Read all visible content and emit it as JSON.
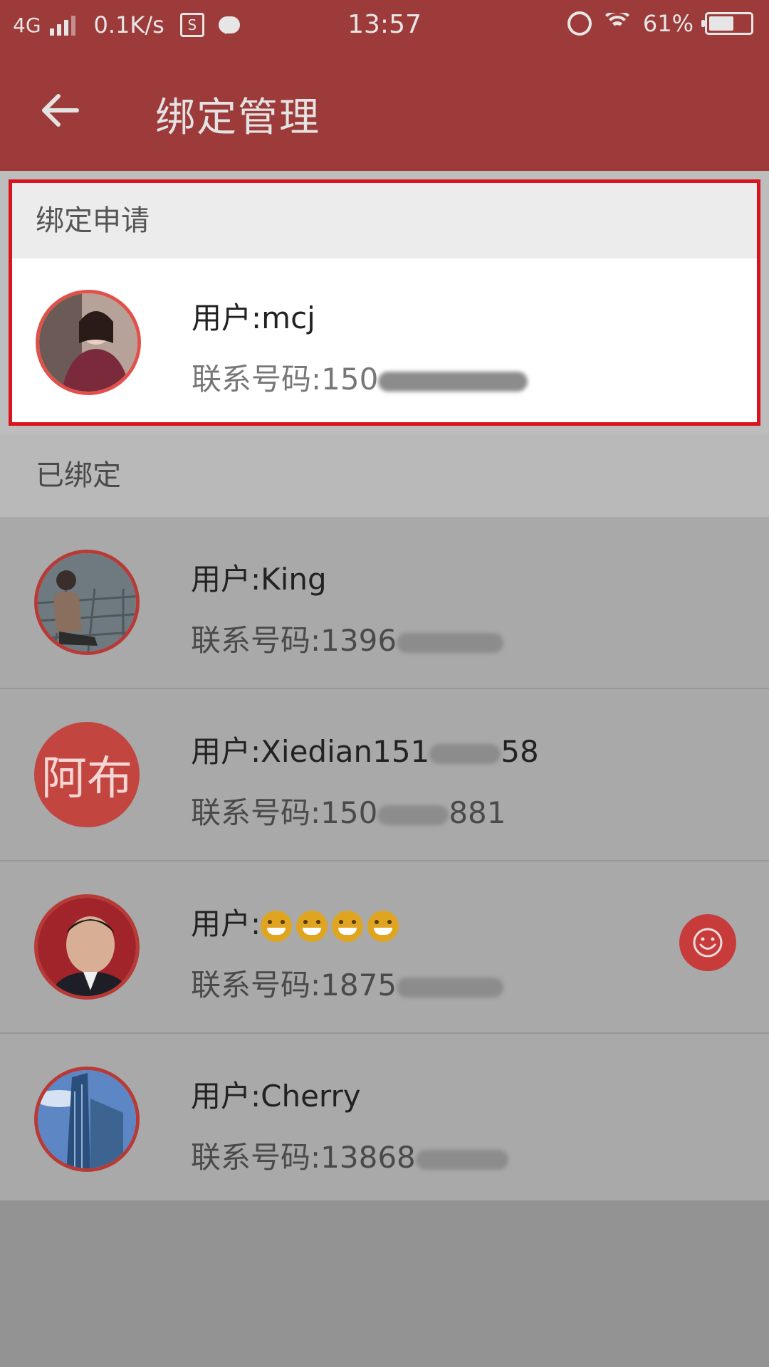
{
  "status_bar": {
    "network": "4G",
    "speed": "0.1K/s",
    "time": "13:57",
    "battery_pct": "61%",
    "battery_level": 0.61
  },
  "header": {
    "title": "绑定管理",
    "back_icon": "arrow-left-icon"
  },
  "apply_section": {
    "title": "绑定申请",
    "items": [
      {
        "user": "用户:mcj",
        "phone_prefix": "联系号码:150",
        "phone_suffix": ""
      }
    ]
  },
  "bound_section": {
    "title": "已绑定",
    "items": [
      {
        "user": "用户:King",
        "user_suffix": "",
        "phone_prefix": "联系号码:1396",
        "phone_suffix": ""
      },
      {
        "user": "用户:Xiedian151",
        "user_suffix": "58",
        "avatar_text": "阿布",
        "phone_prefix": "联系号码:150",
        "phone_suffix": "881"
      },
      {
        "user": "用户:",
        "user_suffix": "",
        "phone_prefix": "联系号码:1875",
        "phone_suffix": ""
      },
      {
        "user": "用户:Cherry",
        "user_suffix": "",
        "phone_prefix": "联系号码:13868",
        "phone_suffix": ""
      }
    ]
  },
  "fab": {
    "icon": "smiley-icon"
  }
}
